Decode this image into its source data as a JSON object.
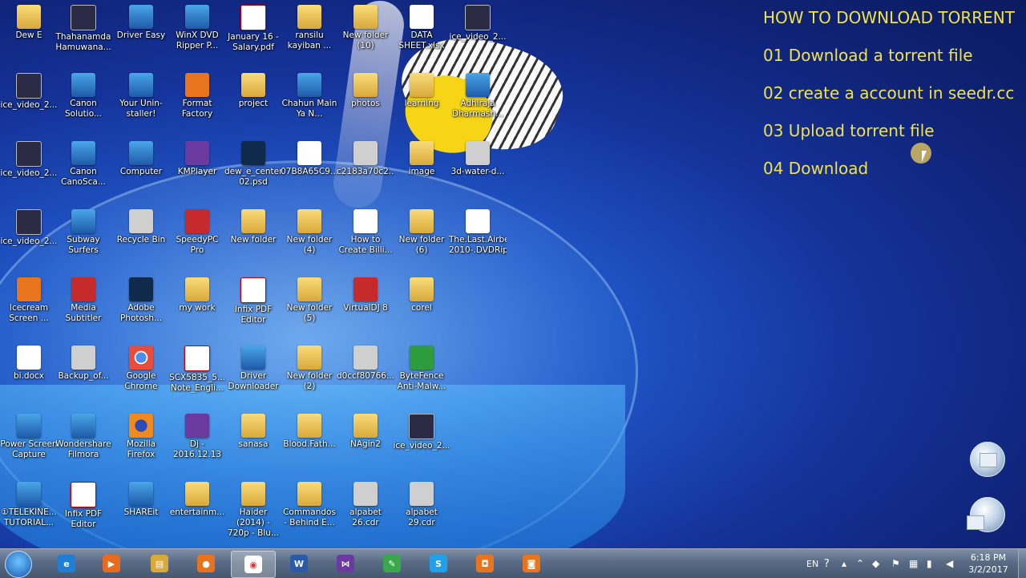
{
  "overlay": {
    "title": "HOW TO DOWNLOAD TORRENT",
    "steps": [
      "01 Download a torrent  file",
      "02 create a account in seedr.cc",
      "03 Upload torrent file",
      "04 Download"
    ]
  },
  "desktop": {
    "icons": [
      {
        "label": "Dew E",
        "icon": "folder-icon"
      },
      {
        "label": "Thahanamda Hamuwana...",
        "icon": "mkv-video-icon"
      },
      {
        "label": "Driver Easy",
        "icon": "driver-easy-icon"
      },
      {
        "label": "WinX DVD Ripper P...",
        "icon": "winx-dvd-icon"
      },
      {
        "label": "January 16 -Salary.pdf",
        "icon": "pdf-icon"
      },
      {
        "label": "ransilu kayiban ...",
        "icon": "folder-icon"
      },
      {
        "label": "New folder (10)",
        "icon": "folder-icon"
      },
      {
        "label": "DATA SHEET.xlsx",
        "icon": "excel-icon"
      },
      {
        "label": "ice_video_2...",
        "icon": "webm-icon"
      },
      {
        "label": "ice_video_2...",
        "icon": "webm-icon"
      },
      {
        "label": "Canon Solutio...",
        "icon": "canon-icon"
      },
      {
        "label": "Your Unin-staller!",
        "icon": "uninstaller-icon"
      },
      {
        "label": "Format Factory",
        "icon": "format-factory-icon"
      },
      {
        "label": "project",
        "icon": "folder-icon"
      },
      {
        "label": "Chahun Main Ya N...",
        "icon": "video-icon"
      },
      {
        "label": "photos",
        "icon": "folder-icon"
      },
      {
        "label": "learning",
        "icon": "folder-icon"
      },
      {
        "label": "Adhiraja Dharmash...",
        "icon": "video-icon"
      },
      {
        "label": "ice_video_2...",
        "icon": "webm-icon"
      },
      {
        "label": "Canon CanoSca...",
        "icon": "canon-icon"
      },
      {
        "label": "Computer",
        "icon": "computer-icon"
      },
      {
        "label": "KMPlayer",
        "icon": "kmplayer-icon"
      },
      {
        "label": "dew_e_center 02.psd",
        "icon": "photoshop-file-icon"
      },
      {
        "label": "07B8A65C9...",
        "icon": "torrent-icon"
      },
      {
        "label": "c2183a70c2...",
        "icon": "image-file-icon"
      },
      {
        "label": "image",
        "icon": "folder-icon"
      },
      {
        "label": "3d-water-d...",
        "icon": "image-file-icon"
      },
      {
        "label": "ice_video_2...",
        "icon": "webm-icon"
      },
      {
        "label": "Subway Surfers",
        "icon": "subway-surfers-icon"
      },
      {
        "label": "Recycle Bin",
        "icon": "recycle-bin-icon"
      },
      {
        "label": "SpeedyPC Pro",
        "icon": "speedypc-icon"
      },
      {
        "label": "New folder",
        "icon": "folder-icon"
      },
      {
        "label": "New folder (4)",
        "icon": "folder-icon"
      },
      {
        "label": "How to Create Billi...",
        "icon": "document-icon"
      },
      {
        "label": "New folder (6)",
        "icon": "folder-icon"
      },
      {
        "label": "The.Last.Airbender-2010-.DVDRip.torrent",
        "icon": "torrent-icon"
      },
      {
        "label": "Icecream Screen ...",
        "icon": "icecream-icon"
      },
      {
        "label": "Media Subtitler",
        "icon": "media-subtitler-icon"
      },
      {
        "label": "Adobe Photosh...",
        "icon": "photoshop-icon"
      },
      {
        "label": "my work",
        "icon": "folder-icon"
      },
      {
        "label": "Infix PDF Editor",
        "icon": "infix-pdf-icon"
      },
      {
        "label": "New folder (5)",
        "icon": "folder-icon"
      },
      {
        "label": "VirtualDJ 8",
        "icon": "virtualdj-icon"
      },
      {
        "label": "corel",
        "icon": "folder-icon"
      },
      {
        "label": "bi.docx",
        "icon": "word-doc-icon"
      },
      {
        "label": "Backup_of...",
        "icon": "backup-file-icon"
      },
      {
        "label": "Google Chrome",
        "icon": "chrome-icon"
      },
      {
        "label": "SCX5835_5... Note_Engli...",
        "icon": "pdf-icon"
      },
      {
        "label": "Driver Downloader",
        "icon": "driver-downloader-icon"
      },
      {
        "label": "New folder (2)",
        "icon": "folder-icon"
      },
      {
        "label": "d0ccf80766...",
        "icon": "image-file-icon"
      },
      {
        "label": "ByteFence Anti-Malw...",
        "icon": "bytefence-icon"
      },
      {
        "label": "Power Screen Capture",
        "icon": "power-screen-icon"
      },
      {
        "label": "Wondershare Filmora",
        "icon": "filmora-icon"
      },
      {
        "label": "Mozilla Firefox",
        "icon": "firefox-icon"
      },
      {
        "label": "Dj - 2016.12.13",
        "icon": "archive-icon"
      },
      {
        "label": "sanasa",
        "icon": "folder-icon"
      },
      {
        "label": "Blood.Fath...",
        "icon": "folder-icon"
      },
      {
        "label": "NAgin2",
        "icon": "folder-icon"
      },
      {
        "label": "ice_video_2...",
        "icon": "webm-icon"
      },
      {
        "label": "①TELEKINE... TUTORIAL...",
        "icon": "video-file-icon"
      },
      {
        "label": "Infix PDF Editor",
        "icon": "infix-pdf-icon"
      },
      {
        "label": "SHAREit",
        "icon": "shareit-icon"
      },
      {
        "label": "entertainm...",
        "icon": "folder-icon"
      },
      {
        "label": "Haider (2014) - 720p - Blu...",
        "icon": "folder-icon"
      },
      {
        "label": "Commandos - Behind E...",
        "icon": "folder-icon"
      },
      {
        "label": "alpabet 26.cdr",
        "icon": "cdr-file-icon"
      },
      {
        "label": "alpabet 29.cdr",
        "icon": "cdr-file-icon"
      }
    ]
  },
  "taskbar": {
    "items": [
      {
        "name": "internet-explorer",
        "glyph": "e"
      },
      {
        "name": "media-player",
        "glyph": "▶"
      },
      {
        "name": "file-explorer",
        "glyph": "▤"
      },
      {
        "name": "firefox",
        "glyph": "●"
      },
      {
        "name": "chrome",
        "glyph": "◉"
      },
      {
        "name": "word",
        "glyph": "W"
      },
      {
        "name": "visual-studio",
        "glyph": "⋈"
      },
      {
        "name": "filmora",
        "glyph": "✎"
      },
      {
        "name": "skype",
        "glyph": "S"
      },
      {
        "name": "screen-recorder",
        "glyph": "◘"
      },
      {
        "name": "camera",
        "glyph": "◙"
      }
    ],
    "language": "EN",
    "time": "6:18 PM",
    "date": "3/2/2017"
  }
}
